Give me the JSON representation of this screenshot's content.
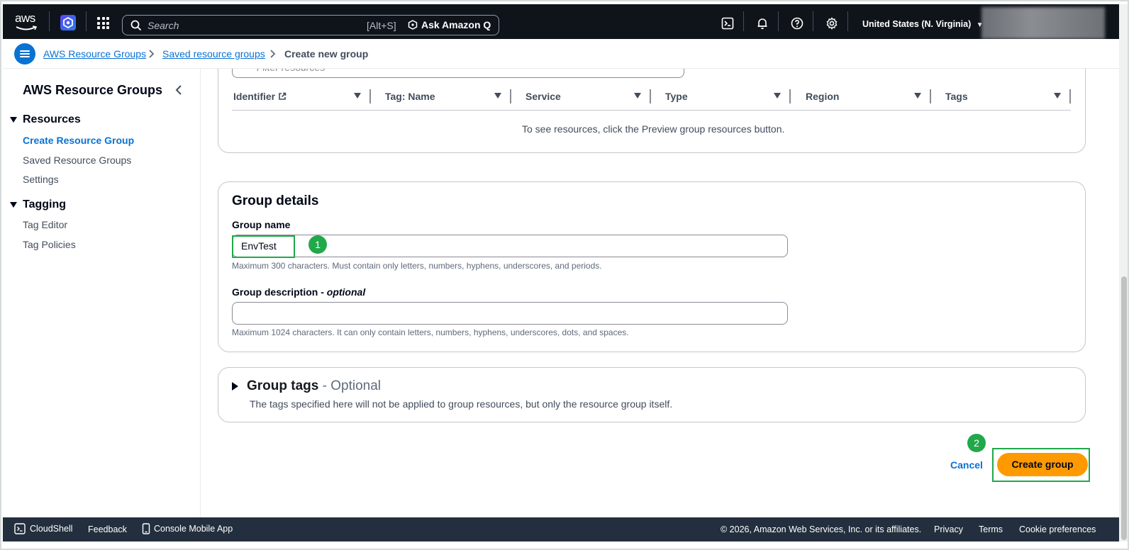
{
  "topnav": {
    "logo_text": "aws",
    "search": {
      "placeholder": "Search",
      "shortcut": "[Alt+S]",
      "ask_q": "Ask Amazon Q"
    },
    "region": "United States (N. Virginia)",
    "icons": [
      "aws-logo-icon",
      "q-hex-icon",
      "apps-grid-icon",
      "search-icon",
      "cloudshell-icon",
      "bell-icon",
      "help-icon",
      "gear-icon"
    ]
  },
  "breadcrumb": {
    "items": [
      "AWS Resource Groups",
      "Saved resource groups",
      "Create new group"
    ]
  },
  "sidebar": {
    "title": "AWS Resource Groups",
    "sections": [
      {
        "label": "Resources",
        "items": [
          "Create Resource Group",
          "Saved Resource Groups",
          "Settings"
        ]
      },
      {
        "label": "Tagging",
        "items": [
          "Tag Editor",
          "Tag Policies"
        ]
      }
    ],
    "active_item": "Create Resource Group"
  },
  "resources_table": {
    "filter_placeholder": "Filter resources",
    "columns": [
      "Identifier",
      "Tag: Name",
      "Service",
      "Type",
      "Region",
      "Tags"
    ],
    "empty_text": "To see resources, click the Preview group resources button."
  },
  "group_details": {
    "heading": "Group details",
    "name_label": "Group name",
    "name_value": "EnvTest",
    "name_hint": "Maximum 300 characters. Must contain only letters, numbers, hyphens, underscores, and periods.",
    "desc_label": "Group description - ",
    "desc_label_optional": "optional",
    "desc_value": "",
    "desc_hint": "Maximum 1024 characters. It can only contain letters, numbers, hyphens, underscores, dots, and spaces."
  },
  "group_tags": {
    "heading": "Group tags",
    "heading_suffix": " - Optional",
    "description": "The tags specified here will not be applied to group resources, but only the resource group itself."
  },
  "actions": {
    "cancel": "Cancel",
    "create": "Create group"
  },
  "annotations": {
    "marker1": "1",
    "marker2": "2"
  },
  "footer": {
    "cloudshell": "CloudShell",
    "feedback": "Feedback",
    "mobile": "Console Mobile App",
    "copyright": "© 2026, Amazon Web Services, Inc. or its affiliates.",
    "privacy": "Privacy",
    "terms": "Terms",
    "cookies": "Cookie preferences"
  },
  "colors": {
    "nav_bg": "#0f141a",
    "link": "#0972d3",
    "primary": "#ff9900",
    "annotation": "#21a84a",
    "footer_bg": "#232f3e"
  }
}
